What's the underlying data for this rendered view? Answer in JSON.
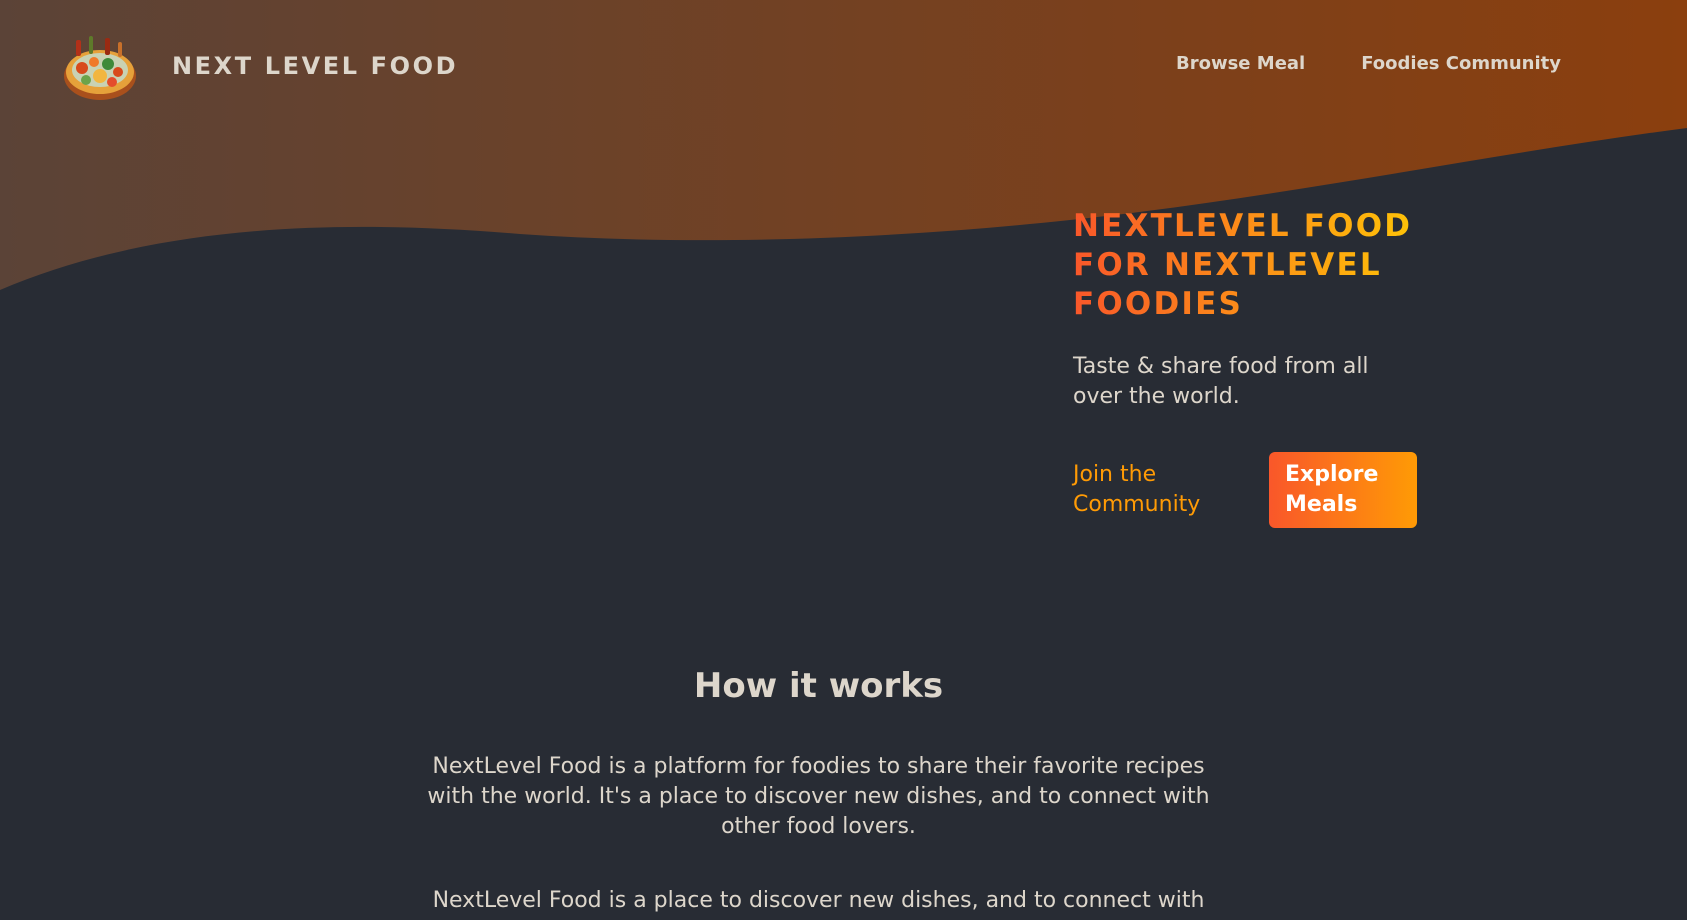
{
  "header": {
    "logo_alt": "A plate with food on it",
    "logo_text": "NEXT LEVEL FOOD",
    "nav": [
      {
        "label": "Browse Meal"
      },
      {
        "label": "Foodies Community"
      }
    ]
  },
  "hero": {
    "title": "NEXTLEVEL FOOD FOR NEXTLEVEL FOODIES",
    "subtitle": "Taste & share food from all over the world.",
    "join_label": "Join the Community",
    "explore_label": "Explore Meals"
  },
  "how_it_works": {
    "title": "How it works",
    "paragraphs": [
      "NextLevel Food is a platform for foodies to share their favorite recipes with the world. It's a place to discover new dishes, and to connect with other food lovers.",
      "NextLevel Food is a place to discover new dishes, and to connect with"
    ]
  },
  "colors": {
    "background": "#282c34",
    "header_gradient_start": "#5b4337",
    "header_gradient_end": "#8b3f0e",
    "text": "#ddd6cb",
    "accent_orange": "#ff9b05",
    "accent_red": "#f9572a",
    "accent_yellow": "#ffc905"
  },
  "icons": {
    "logo": "food-plate-logo"
  }
}
